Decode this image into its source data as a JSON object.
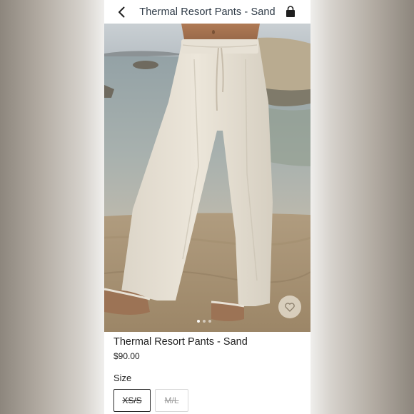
{
  "header": {
    "title": "Thermal Resort Pants - Sand",
    "back_icon": "chevron-left-icon",
    "bag_icon": "shopping-bag-icon"
  },
  "product": {
    "name": "Thermal Resort Pants - Sand",
    "price": "$90.00",
    "image_alt": "Person wearing cream wide-leg drawstring pants and tan slippers standing on a beach",
    "favorite_icon": "heart-icon",
    "image_count": 3,
    "active_image": 1
  },
  "size": {
    "label": "Size",
    "options": [
      {
        "label": "XS/S",
        "selected": true,
        "available": false
      },
      {
        "label": "M/L",
        "selected": false,
        "available": false
      }
    ]
  },
  "colors": {
    "title_text": "#2f3b47",
    "body_text": "#1f1f1f",
    "disabled_text": "#9a9a9a"
  }
}
